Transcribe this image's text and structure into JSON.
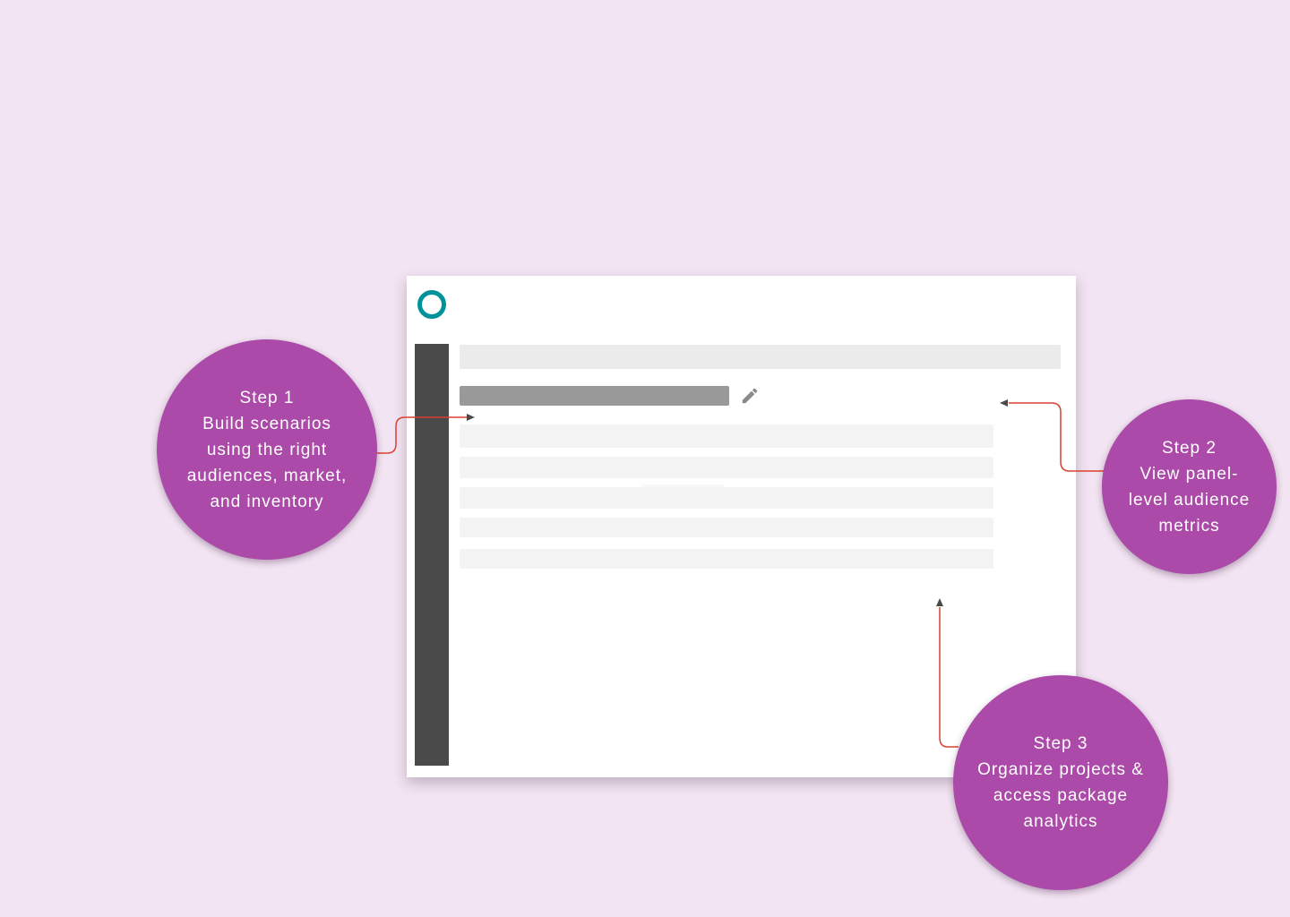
{
  "colors": {
    "background": "#f2e4f2",
    "step_circle": "#ab4aa8",
    "connector_line": "#d9412f",
    "arrow_head": "#4a4a4a",
    "logo_ring": "#00929a",
    "sidebar": "#4a4a4a",
    "placeholder_title": "#999999",
    "placeholder_row": "#f3f3f3"
  },
  "app": {
    "logo_icon": "ring-logo-icon",
    "edit_icon": "pencil-icon",
    "list_row_count": 5
  },
  "steps": [
    {
      "step_label": "Step 1",
      "lines": [
        "Build scenarios",
        "using the right",
        "audiences, market,",
        "and inventory"
      ]
    },
    {
      "step_label": "Step 2",
      "lines": [
        "View panel-",
        "level audience",
        "metrics"
      ]
    },
    {
      "step_label": "Step 3",
      "lines": [
        "Organize projects &",
        "access package",
        "analytics"
      ]
    }
  ]
}
